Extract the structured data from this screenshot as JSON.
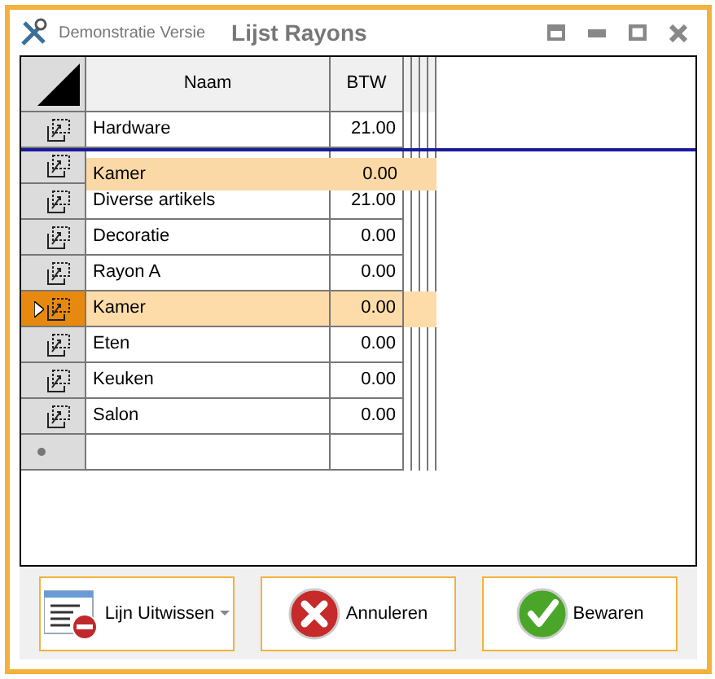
{
  "window": {
    "subtitle": "Demonstratie Versie",
    "title": "Lijst Rayons"
  },
  "grid": {
    "columns": [
      "Naam",
      "BTW"
    ],
    "rows": [
      {
        "name": "Hardware",
        "btw": "21.00",
        "selected": false
      },
      {
        "name": "",
        "btw": "",
        "selected": false
      },
      {
        "name": "Diverse artikels",
        "btw": "21.00",
        "selected": false
      },
      {
        "name": "Decoratie",
        "btw": "0.00",
        "selected": false
      },
      {
        "name": "Rayon A",
        "btw": "0.00",
        "selected": false
      },
      {
        "name": "Kamer",
        "btw": "0.00",
        "selected": true
      },
      {
        "name": "Eten",
        "btw": "0.00",
        "selected": false
      },
      {
        "name": "Keuken",
        "btw": "0.00",
        "selected": false
      },
      {
        "name": "Salon",
        "btw": "0.00",
        "selected": false
      }
    ],
    "drag_preview": {
      "name": "Kamer",
      "btw": "0.00"
    }
  },
  "buttons": [
    {
      "kind": "delete",
      "label": "Lijn Uitwissen",
      "dropdown": true
    },
    {
      "kind": "cancel",
      "label": "Annuleren",
      "dropdown": false
    },
    {
      "kind": "save",
      "label": "Bewaren",
      "dropdown": false
    }
  ]
}
